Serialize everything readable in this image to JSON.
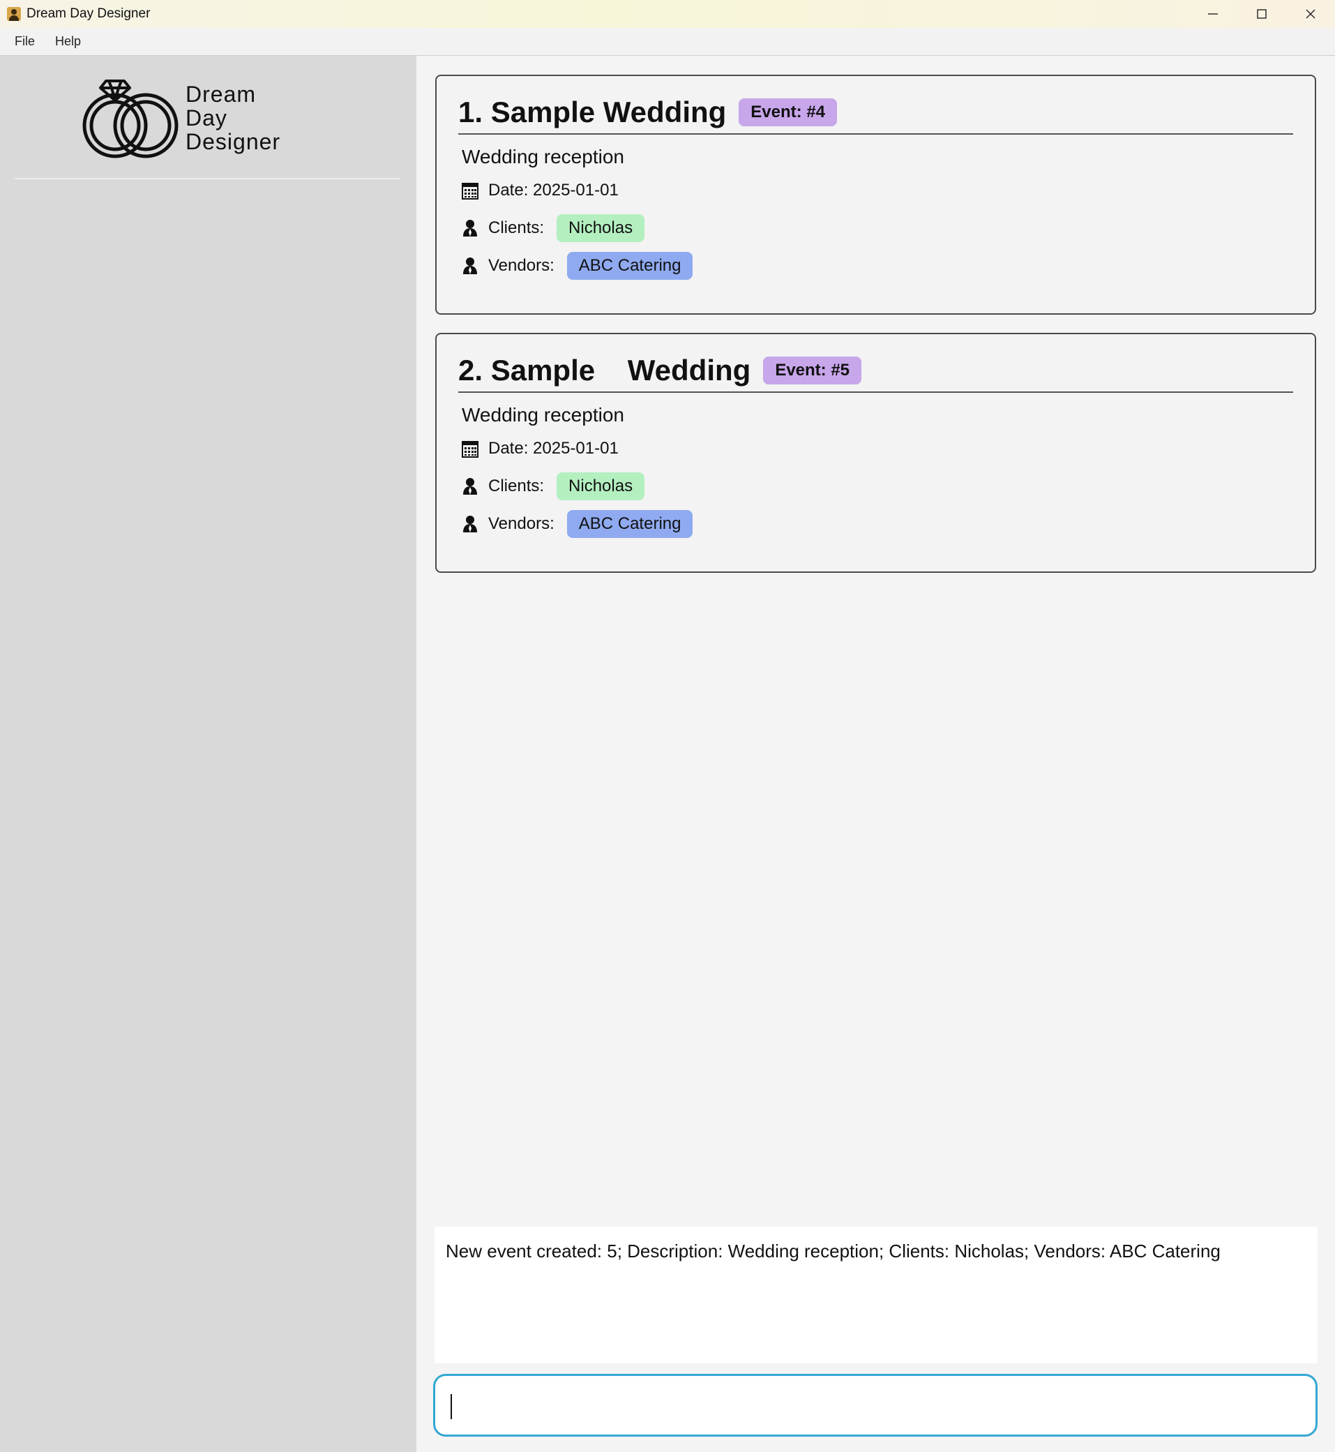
{
  "window": {
    "title": "Dream Day Designer",
    "icon": "app-icon",
    "controls": {
      "minimize": "—",
      "maximize": "☐",
      "close": "✕"
    }
  },
  "menu": [
    {
      "label": "File"
    },
    {
      "label": "Help"
    }
  ],
  "logo": {
    "line1": "Dream",
    "line2": "Day",
    "line3": "Designer",
    "icon": "wedding-rings-icon"
  },
  "events": [
    {
      "index_title": "1. Sample Wedding",
      "badge": "Event: #4",
      "description": "Wedding reception",
      "date_label": "Date: 2025-01-01",
      "clients_label": "Clients:",
      "clients": [
        "Nicholas"
      ],
      "vendors_label": "Vendors:",
      "vendors": [
        "ABC Catering"
      ]
    },
    {
      "index_title": "2. Sample    Wedding",
      "badge": "Event: #5",
      "description": "Wedding reception",
      "date_label": "Date: 2025-01-01",
      "clients_label": "Clients:",
      "clients": [
        "Nicholas"
      ],
      "vendors_label": "Vendors:",
      "vendors": [
        "ABC Catering"
      ]
    }
  ],
  "result_display": {
    "text": "New event created: 5; Description: Wedding reception; Clients: Nicholas; Vendors: ABC Catering"
  },
  "command_box": {
    "value": ""
  },
  "colors": {
    "event_badge": "#c7a6ea",
    "client_tag": "#b4efc0",
    "vendor_tag": "#8faaf0",
    "command_border": "#34a7d2",
    "sidebar": "#d9d9d9"
  }
}
